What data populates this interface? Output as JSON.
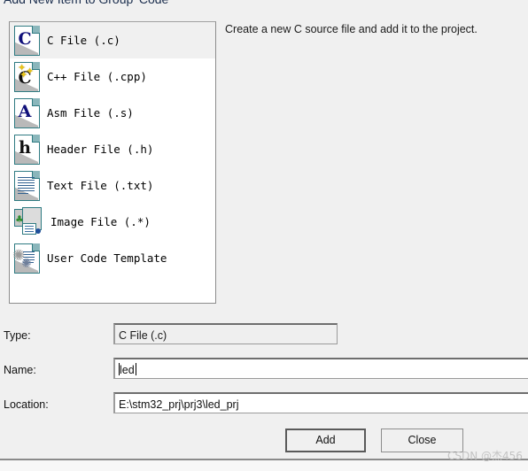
{
  "dialog": {
    "title": "Add New Item to Group 'Code'"
  },
  "type_list": {
    "selected_index": 0,
    "items": [
      {
        "label": "C File (.c)",
        "icon": "c-file-icon",
        "glyph": "C"
      },
      {
        "label": "C++ File (.cpp)",
        "icon": "cpp-file-icon",
        "glyph": "C"
      },
      {
        "label": "Asm File (.s)",
        "icon": "asm-file-icon",
        "glyph": "A"
      },
      {
        "label": "Header File (.h)",
        "icon": "header-file-icon",
        "glyph": "h"
      },
      {
        "label": "Text File (.txt)",
        "icon": "text-file-icon",
        "glyph": ""
      },
      {
        "label": "Image File (.*)",
        "icon": "image-file-icon",
        "glyph": ""
      },
      {
        "label": "User Code Template",
        "icon": "user-template-icon",
        "glyph": ""
      }
    ]
  },
  "description": {
    "text": "Create a new C source file and add it to the project."
  },
  "form": {
    "type": {
      "label": "Type:",
      "value": "C File (.c)"
    },
    "name": {
      "label": "Name:",
      "value": "led",
      "placeholder": ""
    },
    "location": {
      "label": "Location:",
      "value": "E:\\stm32_prj\\prj3\\led_prj",
      "placeholder": ""
    }
  },
  "buttons": {
    "add": "Add",
    "close": "Close"
  },
  "watermark": {
    "text": "CSDN @杰456"
  },
  "colors": {
    "dialog_background": "#f0f0f0",
    "list_background": "#ffffff",
    "selection": "#f0f0f0",
    "icon_teal": "#2f7b82",
    "glyph_blue": "#10107a",
    "watermark": "#c3c3c3"
  }
}
